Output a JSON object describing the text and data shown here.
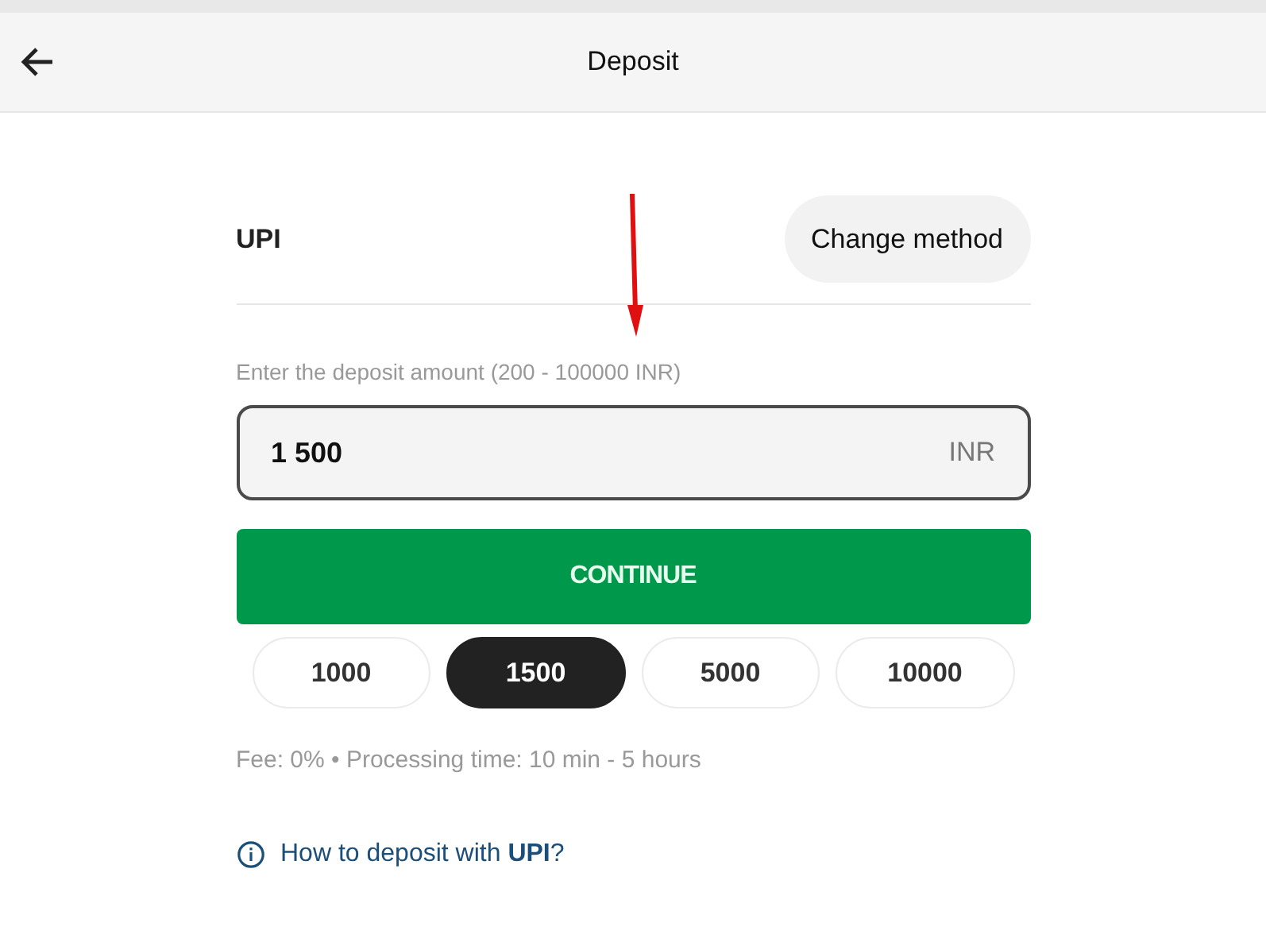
{
  "header": {
    "title": "Deposit"
  },
  "method": {
    "name": "UPI",
    "change_button": "Change method"
  },
  "amount": {
    "label": "Enter the deposit amount (200 - 100000 INR)",
    "value": "1 500",
    "currency": "INR"
  },
  "continue_button": "CONTINUE",
  "presets": [
    {
      "label": "1000",
      "selected": false
    },
    {
      "label": "1500",
      "selected": true
    },
    {
      "label": "5000",
      "selected": false
    },
    {
      "label": "10000",
      "selected": false
    }
  ],
  "info": "Fee: 0% • Processing time: 10 min - 5 hours",
  "help_link": "How to deposit with **UPI**?"
}
